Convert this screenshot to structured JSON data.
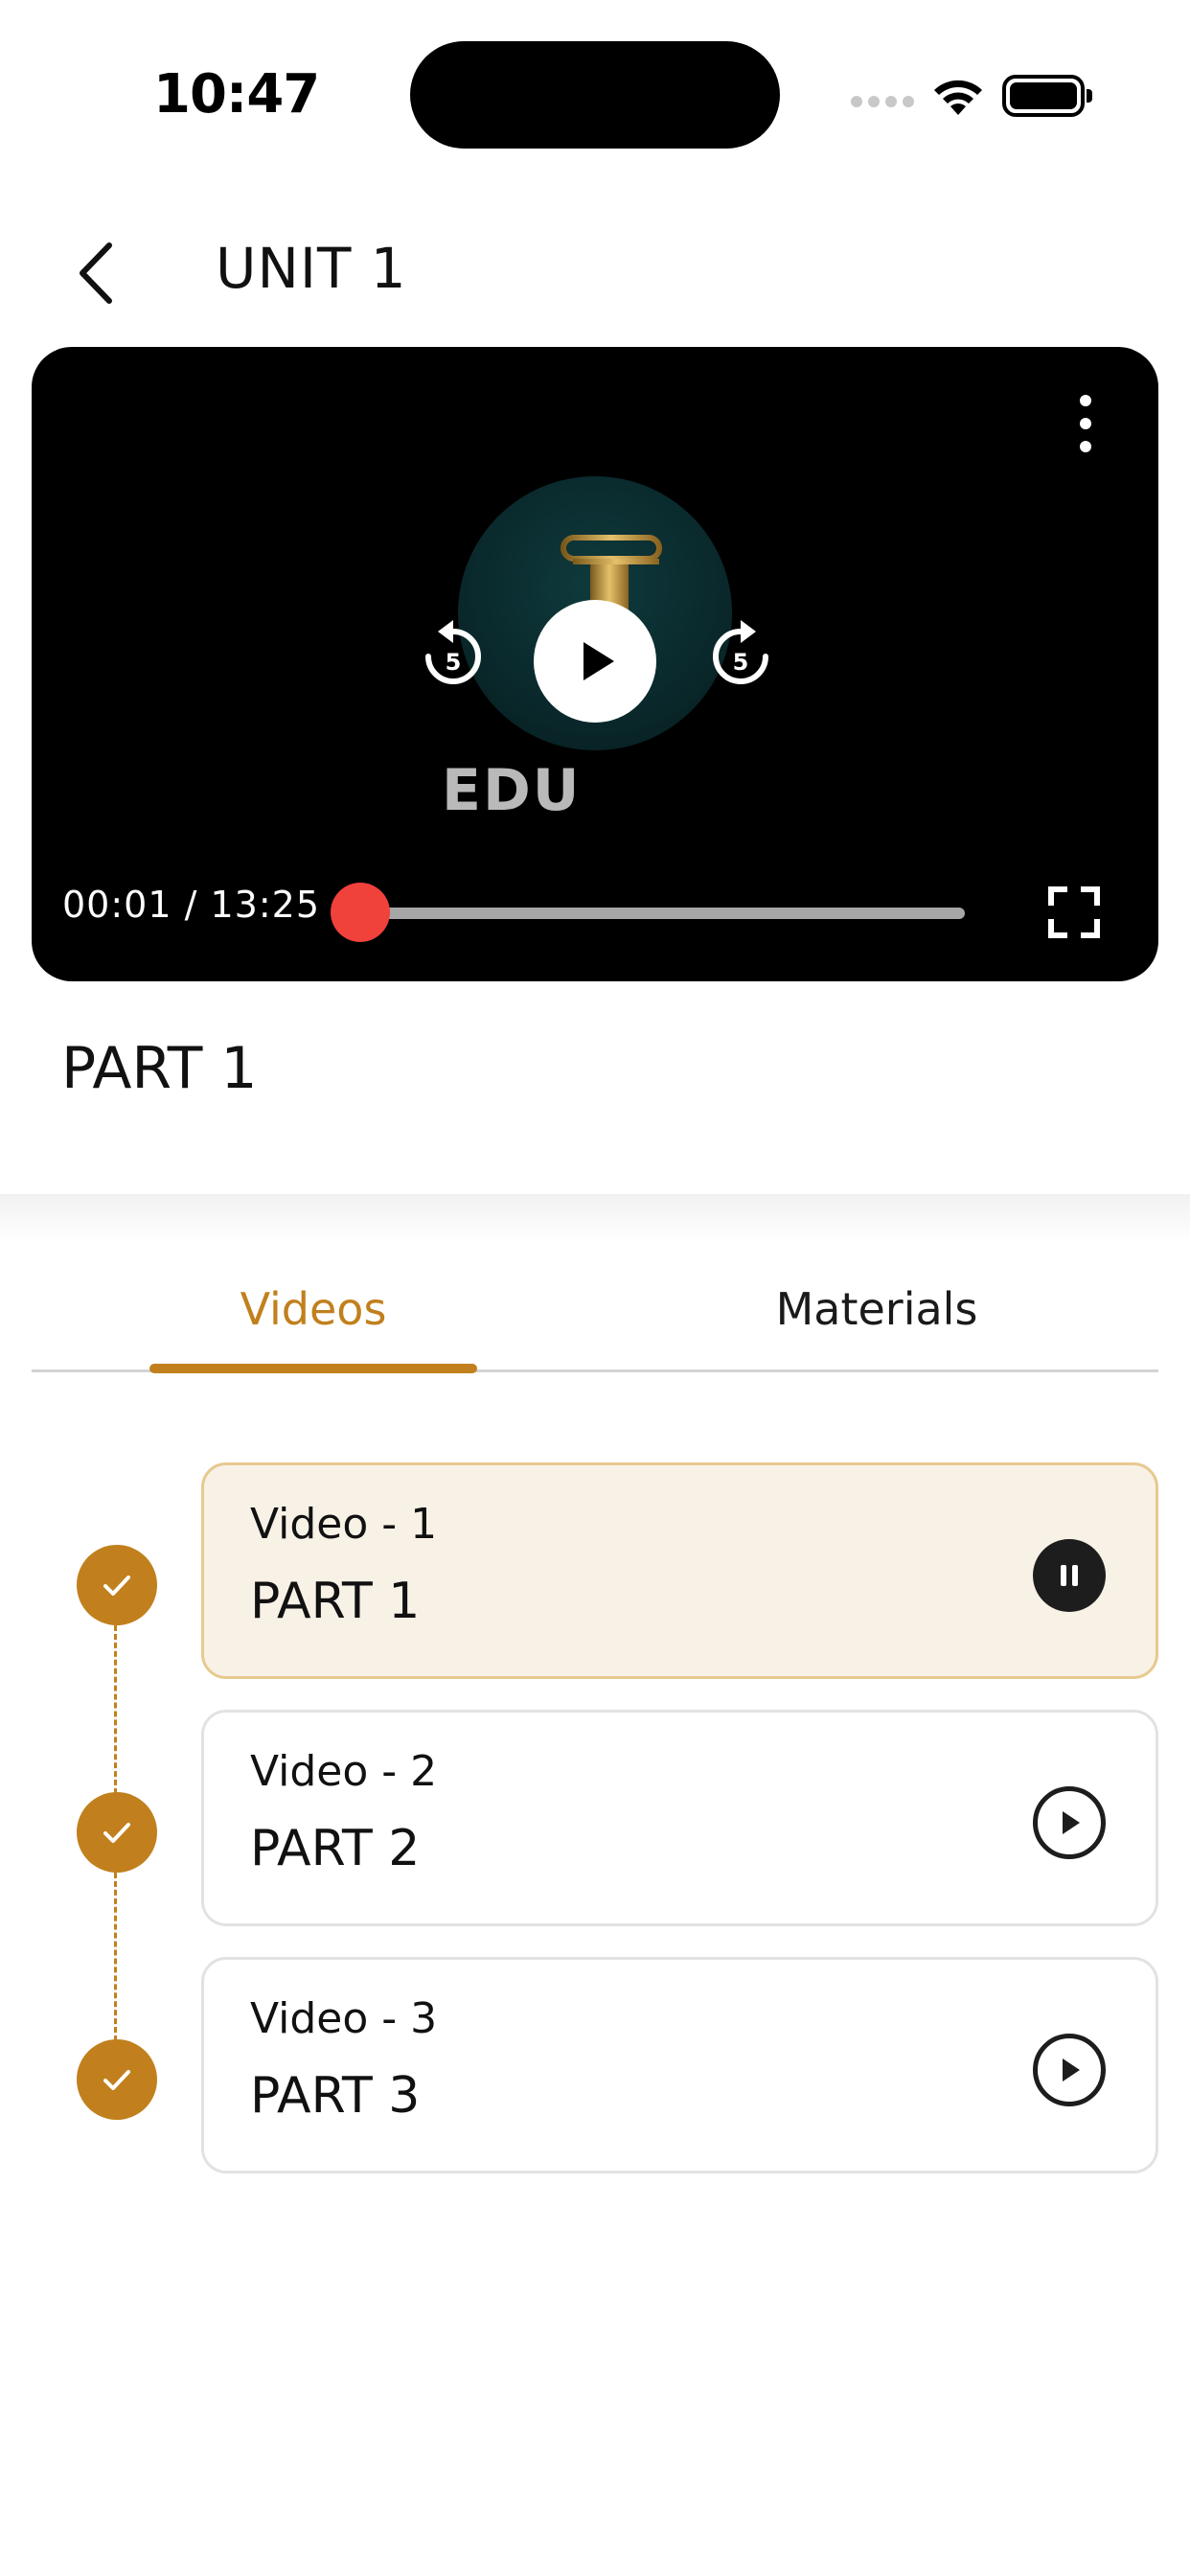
{
  "status_bar": {
    "time": "10:47"
  },
  "header": {
    "title": "UNIT 1",
    "back_icon": "chevron-left-icon"
  },
  "player": {
    "logo_text": "EDU",
    "current_time": "00:01",
    "duration": "13:25",
    "time_separator": " / ",
    "progress_fraction": 0.0013,
    "skip_back_seconds": "5",
    "skip_forward_seconds": "5",
    "accent_color": "#f0413a"
  },
  "part": {
    "title": "PART 1"
  },
  "tabs": [
    {
      "label": "Videos",
      "active": true
    },
    {
      "label": "Materials",
      "active": false
    }
  ],
  "videos": [
    {
      "label": "Video  - 1",
      "title": "PART 1",
      "state": "playing",
      "completed": true
    },
    {
      "label": "Video  - 2",
      "title": "PART 2",
      "state": "idle",
      "completed": true
    },
    {
      "label": "Video  - 3",
      "title": "PART 3",
      "state": "idle",
      "completed": true
    }
  ],
  "theme": {
    "accent": "#c1801d",
    "active_card_bg": "#f8f1e6"
  }
}
